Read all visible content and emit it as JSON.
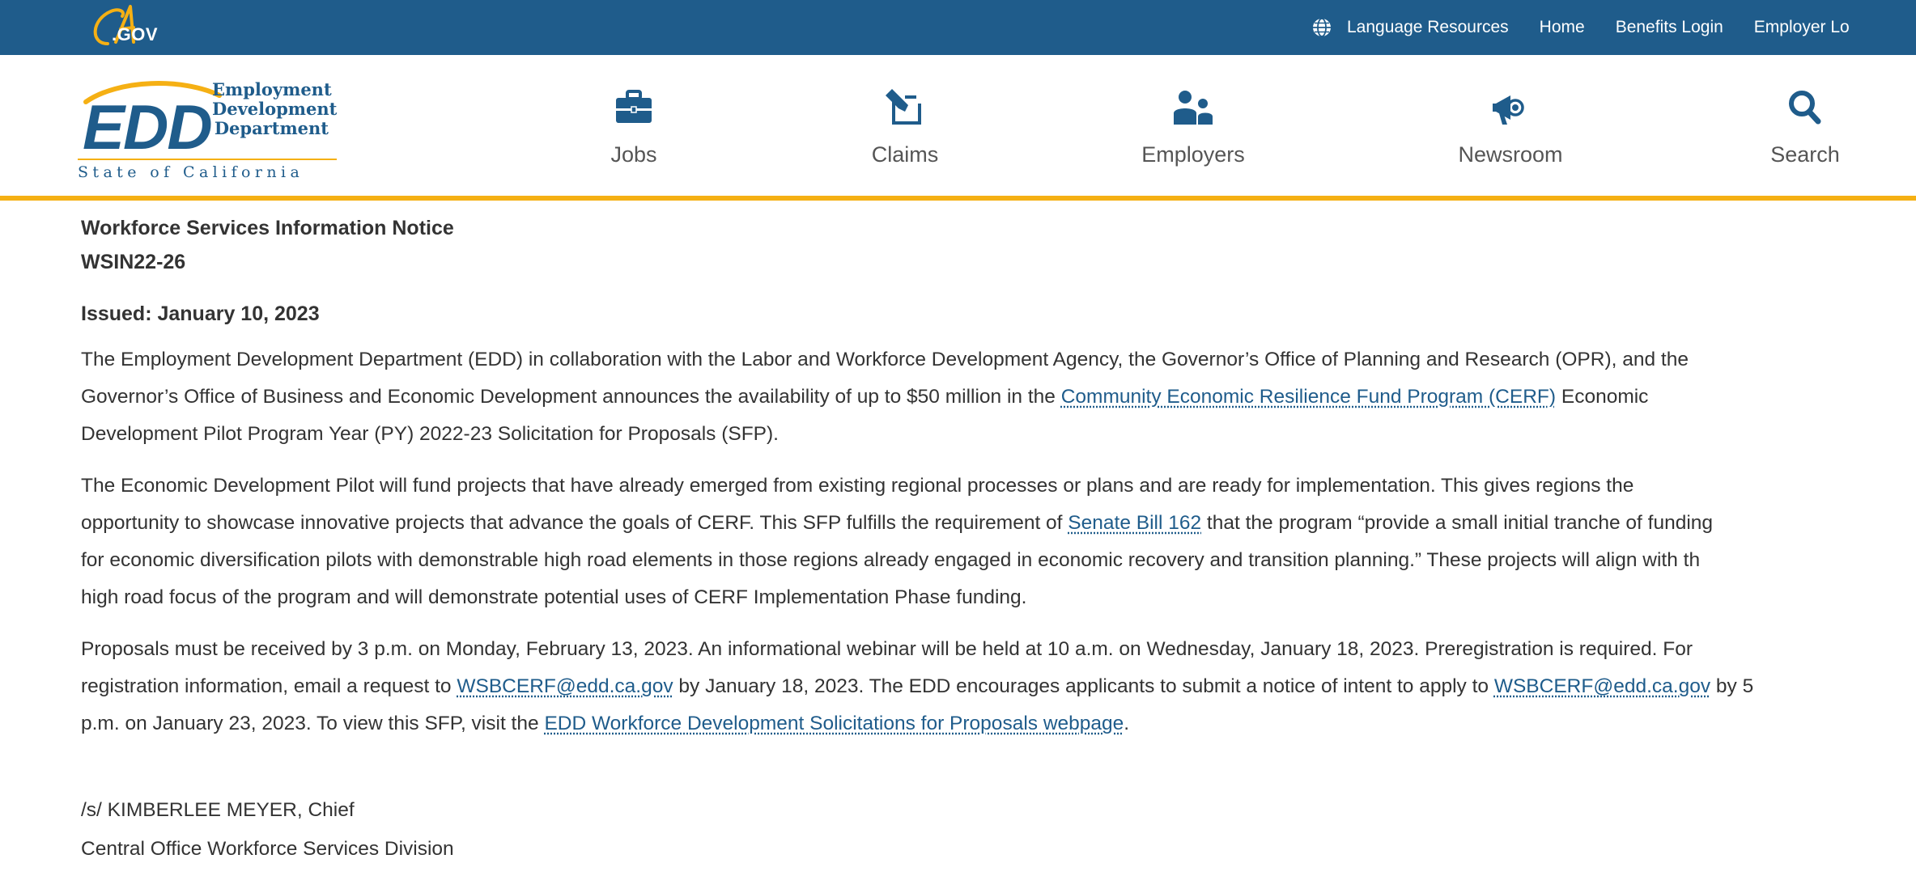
{
  "topbar": {
    "logo_text": ".GOV",
    "language_resources": "Language Resources",
    "home": "Home",
    "benefits_login": "Benefits Login",
    "employer_login": "Employer Lo"
  },
  "logo": {
    "letters": "EDD",
    "line1": "Employment",
    "line2": "Development",
    "line3": "Department",
    "state": "State of California"
  },
  "nav": {
    "jobs": "Jobs",
    "claims": "Claims",
    "employers": "Employers",
    "newsroom": "Newsroom",
    "search": "Search"
  },
  "notice": {
    "title": "Workforce Services Information Notice",
    "code": "WSIN22-26",
    "issued": "Issued: January 10, 2023",
    "p1_l1": "The Employment Development Department (EDD) in collaboration with the Labor and Workforce Development Agency, the Governor’s Office of Planning and Research (OPR), and the",
    "p1_l2a": "Governor’s Office of Business and Economic Development announces the availability of up to $50 million in the ",
    "p1_link": "Community Economic Resilience Fund Program (CERF)",
    "p1_l2b": " Economic",
    "p1_l3": "Development Pilot Program Year (PY) 2022-23 Solicitation for Proposals (SFP).",
    "p2_l1": "The Economic Development Pilot will fund projects that have already emerged from existing regional processes or plans and are ready for implementation. This gives regions the",
    "p2_l2a": "opportunity to showcase innovative projects that advance the goals of CERF. This SFP fulfills the requirement of ",
    "p2_link": "Senate Bill 162",
    "p2_l2b": " that the program “provide a small initial tranche of funding",
    "p2_l3": "for economic diversification pilots with demonstrable high road elements in those regions already engaged in economic recovery and transition planning.” These projects will align with th",
    "p2_l4": "high road focus of the program and will demonstrate potential uses of CERF Implementation Phase funding.",
    "p3_l1": "Proposals must be received by 3 p.m. on Monday, February 13, 2023. An informational webinar will be held at 10 a.m. on Wednesday, January 18, 2023. Preregistration is required. For",
    "p3_l2a": "registration information, email a request to ",
    "p3_email1": "WSBCERF@edd.ca.gov",
    "p3_l2b": " by January 18, 2023. The EDD encourages applicants to submit a notice of intent to apply to ",
    "p3_email2": "WSBCERF@edd.ca.gov",
    "p3_l2c": " by 5",
    "p3_l3a": "p.m. on January 23, 2023. To view this SFP, visit the ",
    "p3_link": "EDD Workforce Development Solicitations for Proposals webpage",
    "p3_l3b": ".",
    "sig1": "/s/ KIMBERLEE MEYER, Chief",
    "sig2": "Central Office Workforce Services Division"
  },
  "colors": {
    "topbar": "#1f5c8b",
    "accent": "#f5b014",
    "link": "#1f5c8b"
  }
}
